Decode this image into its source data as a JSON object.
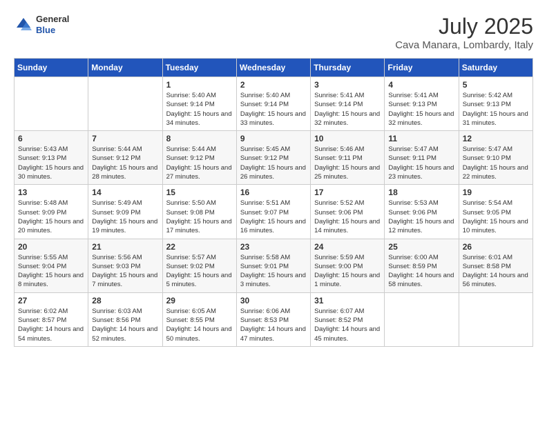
{
  "header": {
    "logo": {
      "general": "General",
      "blue": "Blue"
    },
    "month_year": "July 2025",
    "location": "Cava Manara, Lombardy, Italy"
  },
  "weekdays": [
    "Sunday",
    "Monday",
    "Tuesday",
    "Wednesday",
    "Thursday",
    "Friday",
    "Saturday"
  ],
  "weeks": [
    [
      {
        "day": "",
        "sunrise": "",
        "sunset": "",
        "daylight": ""
      },
      {
        "day": "",
        "sunrise": "",
        "sunset": "",
        "daylight": ""
      },
      {
        "day": "1",
        "sunrise": "Sunrise: 5:40 AM",
        "sunset": "Sunset: 9:14 PM",
        "daylight": "Daylight: 15 hours and 34 minutes."
      },
      {
        "day": "2",
        "sunrise": "Sunrise: 5:40 AM",
        "sunset": "Sunset: 9:14 PM",
        "daylight": "Daylight: 15 hours and 33 minutes."
      },
      {
        "day": "3",
        "sunrise": "Sunrise: 5:41 AM",
        "sunset": "Sunset: 9:14 PM",
        "daylight": "Daylight: 15 hours and 32 minutes."
      },
      {
        "day": "4",
        "sunrise": "Sunrise: 5:41 AM",
        "sunset": "Sunset: 9:13 PM",
        "daylight": "Daylight: 15 hours and 32 minutes."
      },
      {
        "day": "5",
        "sunrise": "Sunrise: 5:42 AM",
        "sunset": "Sunset: 9:13 PM",
        "daylight": "Daylight: 15 hours and 31 minutes."
      }
    ],
    [
      {
        "day": "6",
        "sunrise": "Sunrise: 5:43 AM",
        "sunset": "Sunset: 9:13 PM",
        "daylight": "Daylight: 15 hours and 30 minutes."
      },
      {
        "day": "7",
        "sunrise": "Sunrise: 5:44 AM",
        "sunset": "Sunset: 9:12 PM",
        "daylight": "Daylight: 15 hours and 28 minutes."
      },
      {
        "day": "8",
        "sunrise": "Sunrise: 5:44 AM",
        "sunset": "Sunset: 9:12 PM",
        "daylight": "Daylight: 15 hours and 27 minutes."
      },
      {
        "day": "9",
        "sunrise": "Sunrise: 5:45 AM",
        "sunset": "Sunset: 9:12 PM",
        "daylight": "Daylight: 15 hours and 26 minutes."
      },
      {
        "day": "10",
        "sunrise": "Sunrise: 5:46 AM",
        "sunset": "Sunset: 9:11 PM",
        "daylight": "Daylight: 15 hours and 25 minutes."
      },
      {
        "day": "11",
        "sunrise": "Sunrise: 5:47 AM",
        "sunset": "Sunset: 9:11 PM",
        "daylight": "Daylight: 15 hours and 23 minutes."
      },
      {
        "day": "12",
        "sunrise": "Sunrise: 5:47 AM",
        "sunset": "Sunset: 9:10 PM",
        "daylight": "Daylight: 15 hours and 22 minutes."
      }
    ],
    [
      {
        "day": "13",
        "sunrise": "Sunrise: 5:48 AM",
        "sunset": "Sunset: 9:09 PM",
        "daylight": "Daylight: 15 hours and 20 minutes."
      },
      {
        "day": "14",
        "sunrise": "Sunrise: 5:49 AM",
        "sunset": "Sunset: 9:09 PM",
        "daylight": "Daylight: 15 hours and 19 minutes."
      },
      {
        "day": "15",
        "sunrise": "Sunrise: 5:50 AM",
        "sunset": "Sunset: 9:08 PM",
        "daylight": "Daylight: 15 hours and 17 minutes."
      },
      {
        "day": "16",
        "sunrise": "Sunrise: 5:51 AM",
        "sunset": "Sunset: 9:07 PM",
        "daylight": "Daylight: 15 hours and 16 minutes."
      },
      {
        "day": "17",
        "sunrise": "Sunrise: 5:52 AM",
        "sunset": "Sunset: 9:06 PM",
        "daylight": "Daylight: 15 hours and 14 minutes."
      },
      {
        "day": "18",
        "sunrise": "Sunrise: 5:53 AM",
        "sunset": "Sunset: 9:06 PM",
        "daylight": "Daylight: 15 hours and 12 minutes."
      },
      {
        "day": "19",
        "sunrise": "Sunrise: 5:54 AM",
        "sunset": "Sunset: 9:05 PM",
        "daylight": "Daylight: 15 hours and 10 minutes."
      }
    ],
    [
      {
        "day": "20",
        "sunrise": "Sunrise: 5:55 AM",
        "sunset": "Sunset: 9:04 PM",
        "daylight": "Daylight: 15 hours and 8 minutes."
      },
      {
        "day": "21",
        "sunrise": "Sunrise: 5:56 AM",
        "sunset": "Sunset: 9:03 PM",
        "daylight": "Daylight: 15 hours and 7 minutes."
      },
      {
        "day": "22",
        "sunrise": "Sunrise: 5:57 AM",
        "sunset": "Sunset: 9:02 PM",
        "daylight": "Daylight: 15 hours and 5 minutes."
      },
      {
        "day": "23",
        "sunrise": "Sunrise: 5:58 AM",
        "sunset": "Sunset: 9:01 PM",
        "daylight": "Daylight: 15 hours and 3 minutes."
      },
      {
        "day": "24",
        "sunrise": "Sunrise: 5:59 AM",
        "sunset": "Sunset: 9:00 PM",
        "daylight": "Daylight: 15 hours and 1 minute."
      },
      {
        "day": "25",
        "sunrise": "Sunrise: 6:00 AM",
        "sunset": "Sunset: 8:59 PM",
        "daylight": "Daylight: 14 hours and 58 minutes."
      },
      {
        "day": "26",
        "sunrise": "Sunrise: 6:01 AM",
        "sunset": "Sunset: 8:58 PM",
        "daylight": "Daylight: 14 hours and 56 minutes."
      }
    ],
    [
      {
        "day": "27",
        "sunrise": "Sunrise: 6:02 AM",
        "sunset": "Sunset: 8:57 PM",
        "daylight": "Daylight: 14 hours and 54 minutes."
      },
      {
        "day": "28",
        "sunrise": "Sunrise: 6:03 AM",
        "sunset": "Sunset: 8:56 PM",
        "daylight": "Daylight: 14 hours and 52 minutes."
      },
      {
        "day": "29",
        "sunrise": "Sunrise: 6:05 AM",
        "sunset": "Sunset: 8:55 PM",
        "daylight": "Daylight: 14 hours and 50 minutes."
      },
      {
        "day": "30",
        "sunrise": "Sunrise: 6:06 AM",
        "sunset": "Sunset: 8:53 PM",
        "daylight": "Daylight: 14 hours and 47 minutes."
      },
      {
        "day": "31",
        "sunrise": "Sunrise: 6:07 AM",
        "sunset": "Sunset: 8:52 PM",
        "daylight": "Daylight: 14 hours and 45 minutes."
      },
      {
        "day": "",
        "sunrise": "",
        "sunset": "",
        "daylight": ""
      },
      {
        "day": "",
        "sunrise": "",
        "sunset": "",
        "daylight": ""
      }
    ]
  ]
}
